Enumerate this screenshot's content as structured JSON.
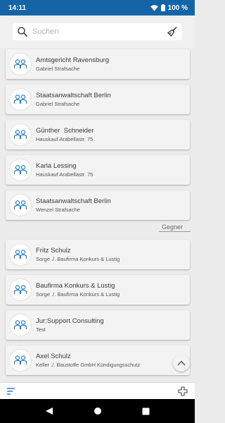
{
  "status_bar": {
    "time": "14:11",
    "battery": "100 %",
    "color": "#1565a6"
  },
  "search": {
    "placeholder": "Suchen",
    "icon": "search-icon",
    "clear_icon": "broom-icon"
  },
  "contacts": [
    {
      "name": "Amtsgericht Ravensburg",
      "matter": "Gabriel Strafsache"
    },
    {
      "name": "Staatsanwaltschaft Berlin",
      "matter": "Gabriel Strafsache"
    },
    {
      "name": "Günther  Schneider",
      "matter": "Hauskauf Arabellastr. 75"
    },
    {
      "name": "Karla Lessing",
      "matter": "Hauskauf Arabellastr. 75"
    },
    {
      "name": "Staatsanwaltschaft Berlin",
      "matter": "Wenzel Strafsache"
    }
  ],
  "section_opponents": "Gegner",
  "opponents": [
    {
      "name": "Fritz Schulz",
      "matter": "Sorge ./. Baufirma Konkurs & Lustig"
    },
    {
      "name": "Baufirma Konkurs & Lustig",
      "matter": "Sorge ./. Baufirma Konkurs & Lustig"
    },
    {
      "name": "Jur:Support Consulting",
      "matter": "Test"
    },
    {
      "name": "Axel Schulz",
      "matter": "Keller ./. Baustoffe GmbH Kündigungsschutz"
    }
  ],
  "bottom_bar": {
    "menu_icon": "menu-lines-icon",
    "add_icon": "add-contact-icon",
    "accent": "#1976c8"
  },
  "nav": {
    "back_icon": "back-triangle-icon",
    "home_icon": "home-circle-icon",
    "recents_icon": "recents-square-icon"
  }
}
